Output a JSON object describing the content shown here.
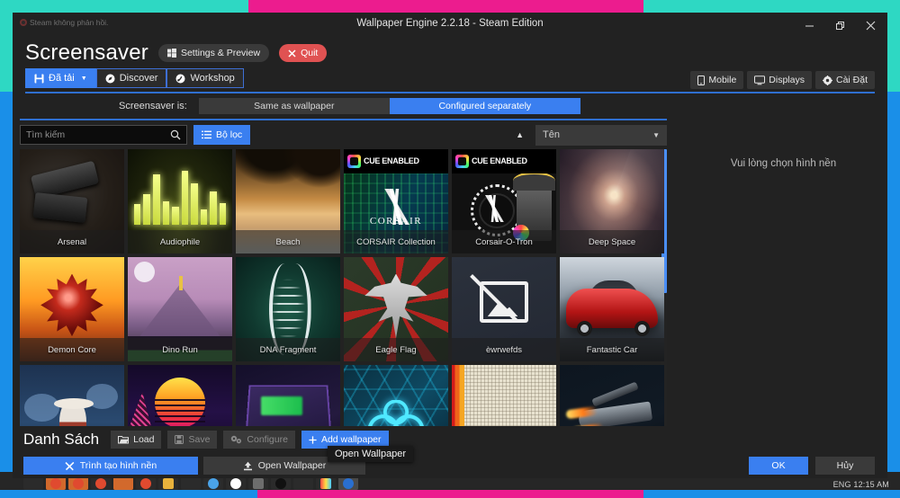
{
  "desktop": {
    "band_teal": "#2ed8c3",
    "band_pink": "#ec1c8e",
    "band_blue": "#1a8fe8",
    "taskbar_clock": "ENG  12:15 AM"
  },
  "window": {
    "title": "Wallpaper Engine 2.2.18 - Steam Edition",
    "minimize_label": "Minimize",
    "restore_label": "Restore",
    "close_label": "Close",
    "steam_toast": "Steam không phản hồi."
  },
  "header": {
    "page_title": "Screensaver",
    "settings_preview_label": "Settings & Preview",
    "quit_label": "Quit"
  },
  "tabs": [
    {
      "label": "Đã tải",
      "active": true,
      "icon": "save-icon",
      "caret": "▼"
    },
    {
      "label": "Discover",
      "active": false,
      "icon": "compass-icon"
    },
    {
      "label": "Workshop",
      "active": false,
      "icon": "workshop-icon"
    }
  ],
  "header_right": [
    {
      "label": "Mobile",
      "icon": "phone-icon"
    },
    {
      "label": "Displays",
      "icon": "monitor-icon"
    },
    {
      "label": "Cài Đặt",
      "icon": "gear-icon"
    }
  ],
  "screensaver_mode": {
    "label": "Screensaver is:",
    "options": [
      {
        "label": "Same as wallpaper",
        "active": false
      },
      {
        "label": "Configured separately",
        "active": true
      }
    ]
  },
  "filters": {
    "search_placeholder": "Tìm kiếm",
    "search_value": "",
    "filter_button_label": "Bộ lọc",
    "sort_value": "Tên",
    "sort_caret": "▲",
    "dropdown_caret": "▼"
  },
  "wallpapers": [
    {
      "name": "Arsenal",
      "art": "t-arsenal",
      "selected": false
    },
    {
      "name": "Audiophile",
      "art": "t-audiophile",
      "selected": false
    },
    {
      "name": "Beach",
      "art": "t-beach",
      "selected": false
    },
    {
      "name": "CORSAIR Collection",
      "art": "t-corsair1",
      "selected": false,
      "badge": "CUE ENABLED"
    },
    {
      "name": "Corsair-O-Tron",
      "art": "t-corsair2",
      "selected": false,
      "badge": "CUE ENABLED"
    },
    {
      "name": "Deep Space",
      "art": "t-deepspace",
      "selected": false
    },
    {
      "name": "Demon Core",
      "art": "t-demon",
      "selected": false
    },
    {
      "name": "Dino Run",
      "art": "t-dino",
      "selected": false
    },
    {
      "name": "DNA Fragment",
      "art": "t-dna",
      "selected": false
    },
    {
      "name": "Eagle Flag",
      "art": "t-eagle",
      "selected": false
    },
    {
      "name": "èwrwefds",
      "art": "t-missing",
      "selected": false
    },
    {
      "name": "Fantastic Car",
      "art": "t-car",
      "selected": true
    },
    {
      "name": "",
      "art": "t-fox",
      "selected": false
    },
    {
      "name": "",
      "art": "t-retro",
      "selected": false
    },
    {
      "name": "",
      "art": "t-neon",
      "selected": false
    },
    {
      "name": "",
      "art": "t-razer",
      "selected": false
    },
    {
      "name": "",
      "art": "t-paper",
      "selected": false
    },
    {
      "name": "",
      "art": "t-jet",
      "selected": false
    }
  ],
  "preview": {
    "empty_hint": "Vui lòng chọn hình nền"
  },
  "playlist": {
    "title": "Danh Sách",
    "load_label": "Load",
    "save_label": "Save",
    "configure_label": "Configure",
    "add_wallpaper_label": "Add wallpaper",
    "tooltip": "Open Wallpaper"
  },
  "actions": {
    "create_wallpaper_label": "Trình tạo hình nền",
    "open_wallpaper_label": "Open Wallpaper",
    "ok_label": "OK",
    "cancel_label": "Hủy"
  },
  "colors": {
    "accent_blue": "#3a7ff0",
    "window_bg": "#222222",
    "quit_red": "#e05252"
  }
}
